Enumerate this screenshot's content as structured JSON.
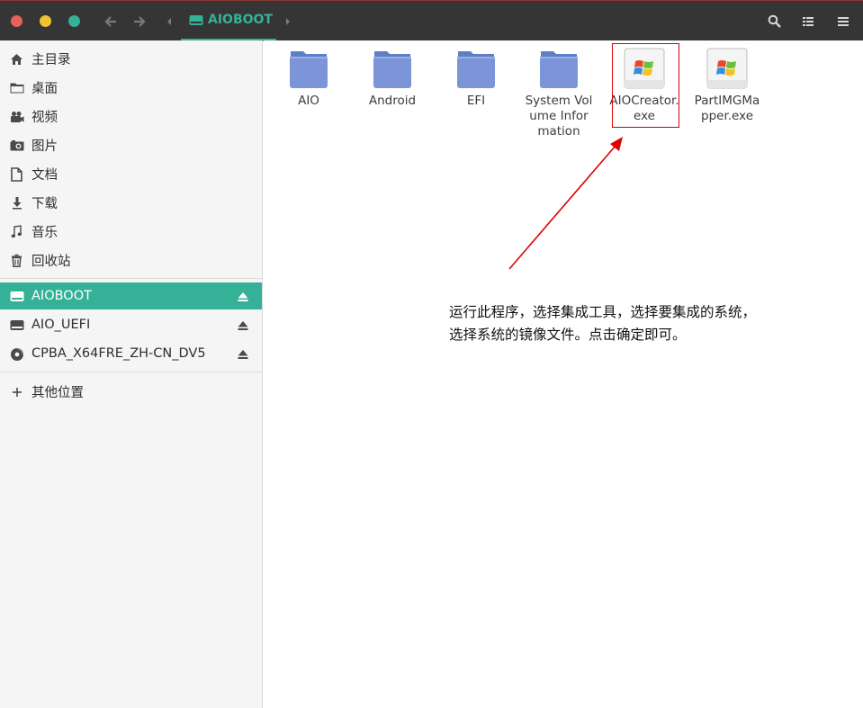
{
  "header": {
    "location": "AIOBOOT"
  },
  "sidebar": {
    "places": [
      {
        "label": "主目录",
        "icon": "home-icon"
      },
      {
        "label": "桌面",
        "icon": "folder-icon"
      },
      {
        "label": "视频",
        "icon": "video-icon"
      },
      {
        "label": "图片",
        "icon": "camera-icon"
      },
      {
        "label": "文档",
        "icon": "document-icon"
      },
      {
        "label": "下载",
        "icon": "download-icon"
      },
      {
        "label": "音乐",
        "icon": "music-icon"
      },
      {
        "label": "回收站",
        "icon": "trash-icon"
      }
    ],
    "devices": [
      {
        "label": "AIOBOOT",
        "icon": "drive-icon",
        "active": true
      },
      {
        "label": "AIO_UEFI",
        "icon": "drive-icon",
        "active": false
      },
      {
        "label": "CPBA_X64FRE_ZH-CN_DV5",
        "icon": "disc-icon",
        "active": false
      }
    ],
    "other_locations": "其他位置"
  },
  "files": [
    {
      "name": "AIO",
      "type": "folder"
    },
    {
      "name": "Android",
      "type": "folder"
    },
    {
      "name": "EFI",
      "type": "folder"
    },
    {
      "name": "System Volume Information",
      "type": "folder"
    },
    {
      "name": "AIOCreator.exe",
      "type": "exe"
    },
    {
      "name": "PartIMGMapper.exe",
      "type": "exe"
    }
  ],
  "annotation": {
    "line1": "运行此程序，选择集成工具，选择要集成的系统，",
    "line2": "选择系统的镜像文件。点击确定即可。"
  },
  "colors": {
    "accent": "#34b196",
    "titlebar": "#353535",
    "folder": "#7b95d8",
    "annotation": "#e00000"
  }
}
